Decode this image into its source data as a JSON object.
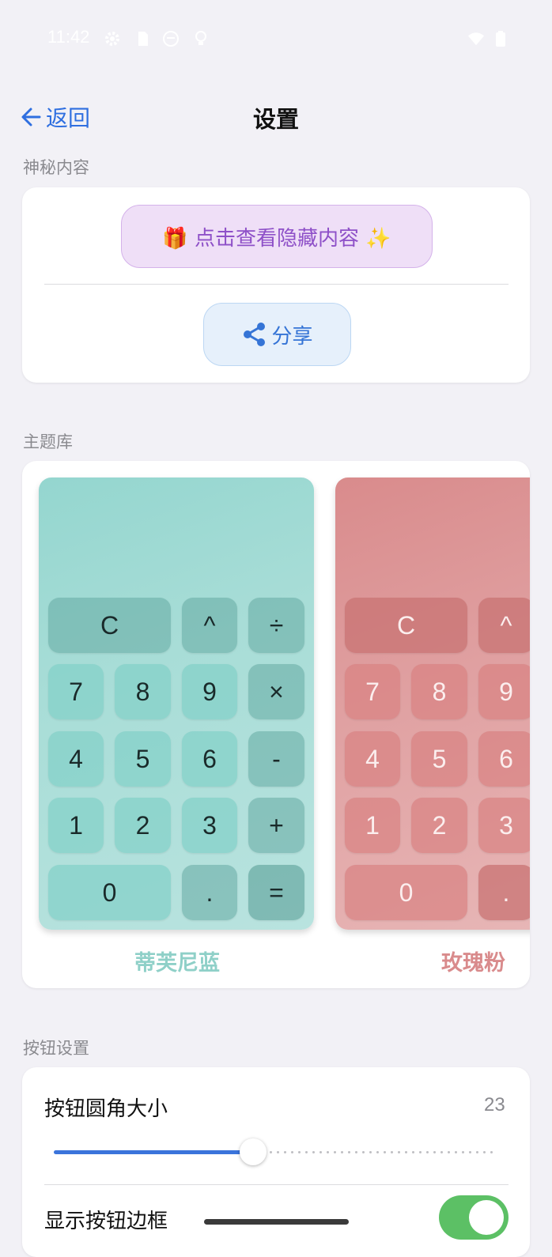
{
  "status": {
    "time": "11:42"
  },
  "header": {
    "back_label": "返回",
    "title": "设置"
  },
  "mystery": {
    "section_label": "神秘内容",
    "reveal_label": "🎁 点击查看隐藏内容 ✨",
    "share_label": "分享"
  },
  "themes": {
    "section_label": "主题库",
    "items": [
      {
        "name": "蒂芙尼蓝",
        "name_color": "#8fd0c8"
      },
      {
        "name": "玫瑰粉",
        "name_color": "#d98b8c"
      }
    ],
    "keys": {
      "c": "C",
      "pow": "^",
      "div": "÷",
      "mul": "×",
      "sub": "-",
      "add": "+",
      "eq": "=",
      "dot": ".",
      "n0": "0",
      "n1": "1",
      "n2": "2",
      "n3": "3",
      "n4": "4",
      "n5": "5",
      "n6": "6",
      "n7": "7",
      "n8": "8",
      "n9": "9"
    }
  },
  "buttons": {
    "section_label": "按钮设置",
    "radius_label": "按钮圆角大小",
    "radius_value": "23",
    "radius_fraction": 0.45,
    "border_label": "显示按钮边框",
    "border_enabled": true
  },
  "colors": {
    "accent": "#2f6fe0",
    "toggle_on": "#5cc065"
  }
}
